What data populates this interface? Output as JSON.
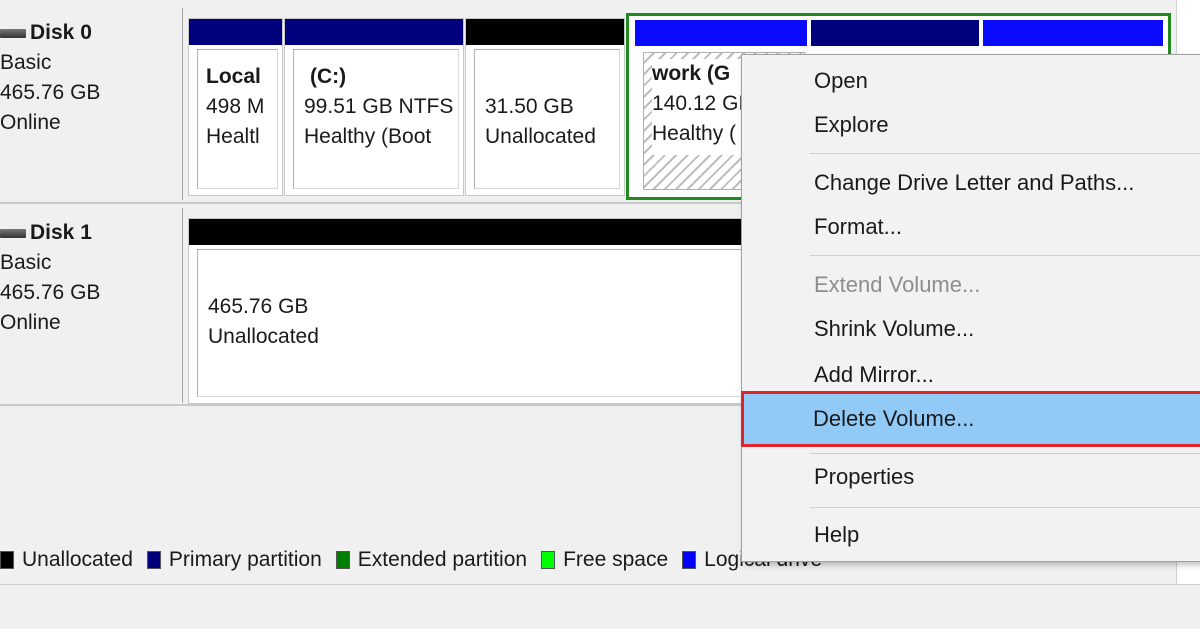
{
  "disks": [
    {
      "name": "Disk 0",
      "type": "Basic",
      "size": "465.76 GB",
      "status": "Online",
      "partitions": [
        {
          "title": "Local",
          "size": "498 M",
          "status": "Healtl",
          "bar_color": "#00007f"
        },
        {
          "title": "(C:)",
          "size": "99.51 GB NTFS",
          "status": "Healthy (Boot",
          "bar_color": "#00007f"
        },
        {
          "title": "",
          "size": "31.50 GB",
          "status": "Unallocated",
          "bar_color": "#000000"
        },
        {
          "title": "work  (G",
          "size": "140.12 GI",
          "status": "Healthy (",
          "bar_color": "#0000ff"
        }
      ]
    },
    {
      "name": "Disk 1",
      "type": "Basic",
      "size": "465.76 GB",
      "status": "Online",
      "partitions": [
        {
          "title": "",
          "size": "465.76 GB",
          "status": "Unallocated",
          "bar_color": "#000000"
        }
      ]
    }
  ],
  "legend": [
    {
      "label": "Unallocated",
      "color": "#000000"
    },
    {
      "label": "Primary partition",
      "color": "#00007f"
    },
    {
      "label": "Extended partition",
      "color": "#008000"
    },
    {
      "label": "Free space",
      "color": "#00ff00"
    },
    {
      "label": "Logical drive",
      "color": "#0000ff"
    }
  ],
  "context_menu": {
    "items": [
      {
        "label": "Open",
        "enabled": true
      },
      {
        "label": "Explore",
        "enabled": true
      },
      {
        "label": "Change Drive Letter and Paths...",
        "enabled": true
      },
      {
        "label": "Format...",
        "enabled": true
      },
      {
        "label": "Extend Volume...",
        "enabled": false
      },
      {
        "label": "Shrink Volume...",
        "enabled": true
      },
      {
        "label": "Add Mirror...",
        "enabled": true
      },
      {
        "label": "Delete Volume...",
        "enabled": true,
        "highlighted": true
      },
      {
        "label": "Properties",
        "enabled": true
      },
      {
        "label": "Help",
        "enabled": true
      }
    ],
    "highlight_color": "#91c9f7",
    "highlight_border_color": "#e0242b"
  },
  "colors": {
    "extended_selection_border": "#1f8a1f",
    "logical_bar_dark": "#00007f"
  }
}
